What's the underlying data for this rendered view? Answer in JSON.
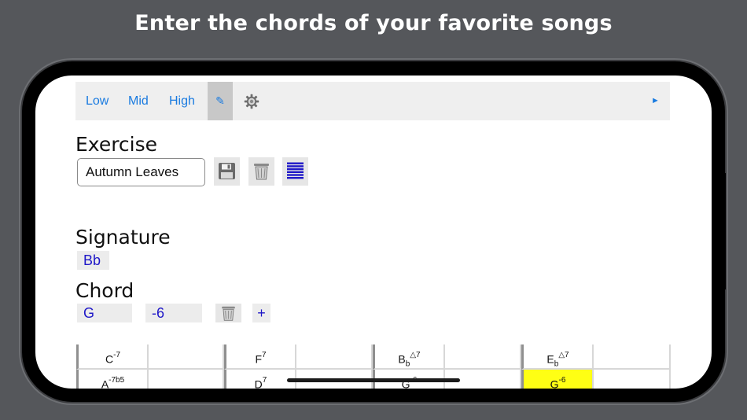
{
  "headline": "Enter the chords of your favorite songs",
  "toolbar": {
    "low": "Low",
    "mid": "Mid",
    "high": "High",
    "pencil_glyph": "✎",
    "play_glyph": "►"
  },
  "exercise": {
    "title": "Exercise",
    "name_value": "Autumn Leaves"
  },
  "signature": {
    "title": "Signature",
    "value": "Bb"
  },
  "chord": {
    "title": "Chord",
    "root": "G",
    "quality": "-6",
    "add_label": "+"
  },
  "grid": {
    "rows": [
      [
        {
          "root": "C",
          "acc": "",
          "ext": "-7"
        },
        {
          "root": "",
          "acc": "",
          "ext": ""
        },
        {
          "root": "F",
          "acc": "",
          "ext": "7"
        },
        {
          "root": "",
          "acc": "",
          "ext": ""
        },
        {
          "root": "B",
          "acc": "b",
          "ext": "△7"
        },
        {
          "root": "",
          "acc": "",
          "ext": ""
        },
        {
          "root": "E",
          "acc": "b",
          "ext": "△7"
        },
        {
          "root": "",
          "acc": "",
          "ext": ""
        }
      ],
      [
        {
          "root": "A",
          "acc": "",
          "ext": "-7b5"
        },
        {
          "root": "",
          "acc": "",
          "ext": ""
        },
        {
          "root": "D",
          "acc": "",
          "ext": "7"
        },
        {
          "root": "",
          "acc": "",
          "ext": ""
        },
        {
          "root": "G",
          "acc": "",
          "ext": "-6"
        },
        {
          "root": "",
          "acc": "",
          "ext": ""
        },
        {
          "root": "G",
          "acc": "",
          "ext": "-6",
          "selected": true
        },
        {
          "root": "",
          "acc": "",
          "ext": ""
        }
      ]
    ]
  },
  "colors": {
    "accent": "#1a7be0",
    "chip_text": "#1f18c8",
    "highlight": "#ffff14",
    "backdrop": "#55575b"
  }
}
